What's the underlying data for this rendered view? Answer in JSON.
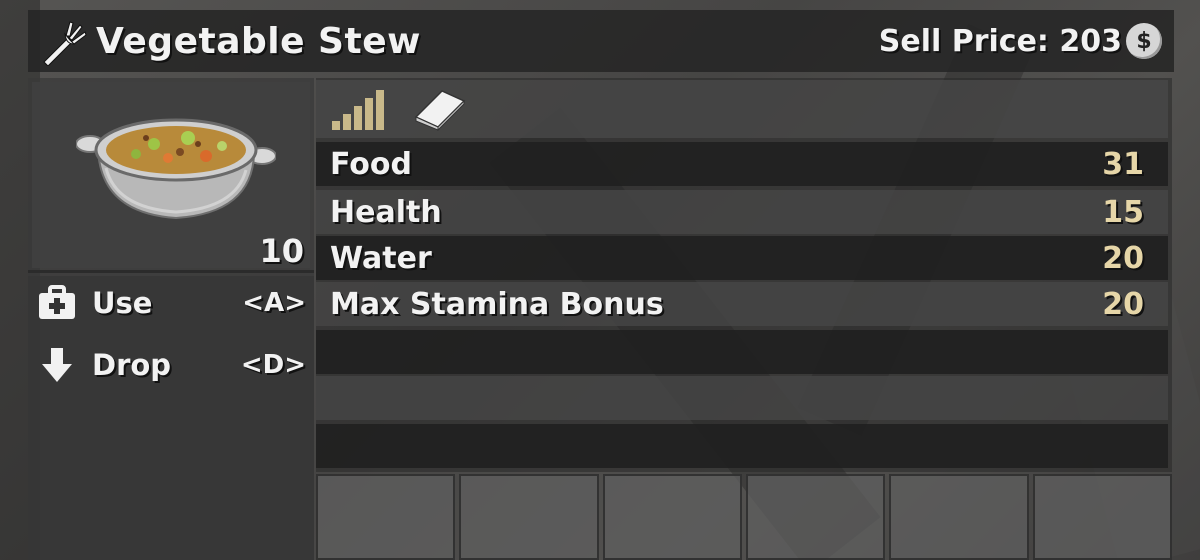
{
  "item": {
    "name": "Vegetable Stew",
    "icon": "fork-icon",
    "sell_price_label": "Sell Price: 203",
    "currency_icon": "coin-icon",
    "currency_symbol": "$",
    "count": "10",
    "image": "vegetable-stew-pot"
  },
  "actions": [
    {
      "label": "Use",
      "key": "<A>",
      "icon": "medkit-icon"
    },
    {
      "label": "Drop",
      "key": "<D>",
      "icon": "arrow-down-icon"
    }
  ],
  "info_icons": [
    "quality-bars-icon",
    "book-icon"
  ],
  "stats": [
    {
      "name": "Food",
      "value": "31"
    },
    {
      "name": "Health",
      "value": "15"
    },
    {
      "name": "Water",
      "value": "20"
    },
    {
      "name": "Max Stamina Bonus",
      "value": "20"
    }
  ],
  "colors": {
    "text": "#f2f2f2",
    "value_text": "#e6d6a8",
    "quality_bars": "#c9b98a"
  }
}
